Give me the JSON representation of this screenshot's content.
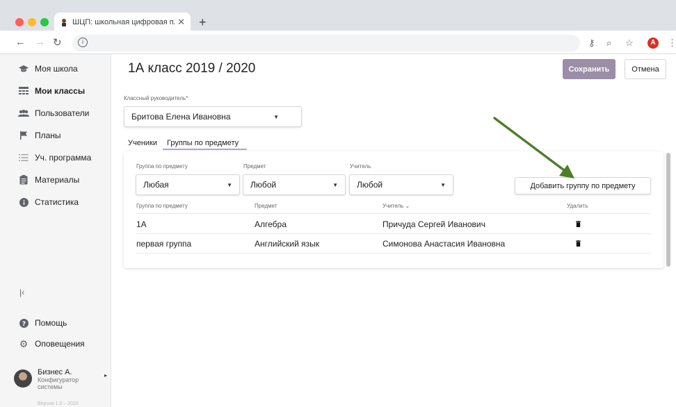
{
  "browser": {
    "tab_title": "ШЦП: школьная цифровая пл",
    "tab_close": "✕",
    "new_tab": "+",
    "omnibox_info": "i",
    "profile_initial": "A"
  },
  "sidebar": {
    "items": [
      {
        "label": "Моя школа",
        "icon": "graduation-cap-icon"
      },
      {
        "label": "Мои классы",
        "icon": "classroom-icon"
      },
      {
        "label": "Пользователи",
        "icon": "users-icon"
      },
      {
        "label": "Планы",
        "icon": "flag-icon"
      },
      {
        "label": "Уч. программа",
        "icon": "list-icon"
      },
      {
        "label": "Материалы",
        "icon": "clipboard-icon"
      },
      {
        "label": "Статистика",
        "icon": "info-icon"
      }
    ],
    "active_index": 1,
    "collapse": "|‹",
    "help": "Помощь",
    "notifications": "Оповещения",
    "user": {
      "name": "Бизнес А.",
      "role": "Конфигуратор системы",
      "footer": "Версия 1.0 – 2020"
    }
  },
  "page": {
    "title": "1А класс 2019 / 2020",
    "save": "Сохранить",
    "cancel": "Отмена",
    "teacher_label": "Классный руководитель*",
    "teacher_value": "Бритова Елена Ивановна"
  },
  "tabs": [
    "Ученики",
    "Группы по предмету"
  ],
  "active_tab": 1,
  "filters": [
    {
      "label": "Группа по предмету",
      "value": "Любая"
    },
    {
      "label": "Предмет",
      "value": "Любой"
    },
    {
      "label": "Учитель",
      "value": "Любой"
    }
  ],
  "add_button": "Добавить группу по предмету",
  "table": {
    "headers": [
      "Группа по предмету",
      "Предмет",
      "Учитель ⌄",
      "Удалить"
    ],
    "rows": [
      {
        "group": "1А",
        "subject": "Алгебра",
        "teacher": "Причуда Сергей Иванович"
      },
      {
        "group": "первая группа",
        "subject": "Английский язык",
        "teacher": "Симонова Анастасия Ивановна"
      }
    ]
  },
  "colors": {
    "save_button": "#9b8ea6",
    "tab_underline": "#b79fd6",
    "arrow": "#4e7d2a"
  }
}
